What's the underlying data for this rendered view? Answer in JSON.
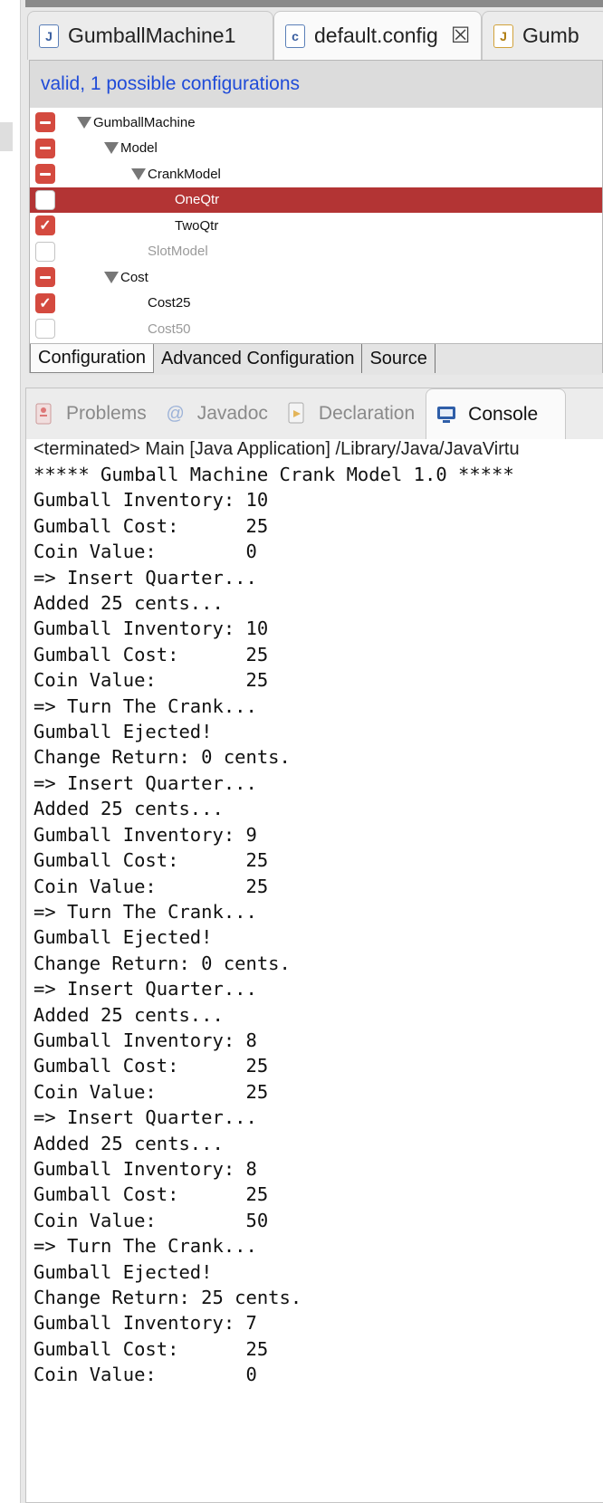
{
  "editor_tabs": [
    {
      "label": "GumballMachine1",
      "icon": "java-file-icon",
      "active": false
    },
    {
      "label": "default.config",
      "icon": "config-file-icon",
      "active": true,
      "closable": true
    },
    {
      "label": "Gumb",
      "icon": "java-file-warning-icon",
      "active": false
    }
  ],
  "config_status": "valid, 1 possible configurations",
  "feature_tree": [
    {
      "label": "GumballMachine",
      "state": "minus",
      "expanded": true
    },
    {
      "label": "Model",
      "state": "minus",
      "expanded": true
    },
    {
      "label": "CrankModel",
      "state": "minus",
      "expanded": true
    },
    {
      "label": "OneQtr",
      "state": "empty",
      "selected": true
    },
    {
      "label": "TwoQtr",
      "state": "checked"
    },
    {
      "label": "SlotModel",
      "state": "empty",
      "disabled": true
    },
    {
      "label": "Cost",
      "state": "minus",
      "expanded": true
    },
    {
      "label": "Cost25",
      "state": "checked"
    },
    {
      "label": "Cost50",
      "state": "empty",
      "disabled": true
    }
  ],
  "editor_bottom_tabs": [
    {
      "label": "Configuration",
      "active": true
    },
    {
      "label": "Advanced Configuration",
      "active": false
    },
    {
      "label": "Source",
      "active": false
    }
  ],
  "view_tabs": [
    {
      "label": "Problems",
      "icon": "problems-icon",
      "active": false
    },
    {
      "label": "Javadoc",
      "icon": "javadoc-icon",
      "active": false
    },
    {
      "label": "Declaration",
      "icon": "declaration-icon",
      "active": false
    },
    {
      "label": "Console",
      "icon": "console-icon",
      "active": true
    }
  ],
  "console_header": "<terminated> Main [Java Application] /Library/Java/JavaVirtu",
  "console_lines": [
    "***** Gumball Machine Crank Model 1.0 *****",
    "Gumball Inventory: 10",
    "Gumball Cost:      25",
    "Coin Value:        0",
    "=> Insert Quarter...",
    "Added 25 cents...",
    "Gumball Inventory: 10",
    "Gumball Cost:      25",
    "Coin Value:        25",
    "=> Turn The Crank...",
    "Gumball Ejected!",
    "Change Return: 0 cents.",
    "=> Insert Quarter...",
    "Added 25 cents...",
    "Gumball Inventory: 9",
    "Gumball Cost:      25",
    "Coin Value:        25",
    "=> Turn The Crank...",
    "Gumball Ejected!",
    "Change Return: 0 cents.",
    "=> Insert Quarter...",
    "Added 25 cents...",
    "Gumball Inventory: 8",
    "Gumball Cost:      25",
    "Coin Value:        25",
    "=> Insert Quarter...",
    "Added 25 cents...",
    "Gumball Inventory: 8",
    "Gumball Cost:      25",
    "Coin Value:        50",
    "=> Turn The Crank...",
    "Gumball Ejected!",
    "Change Return: 25 cents.",
    "Gumball Inventory: 7",
    "Gumball Cost:      25",
    "Coin Value:        0"
  ],
  "colors": {
    "selection": "#b33434",
    "checkbox_red": "#d44a3f",
    "status_blue": "#1f4bd8"
  }
}
